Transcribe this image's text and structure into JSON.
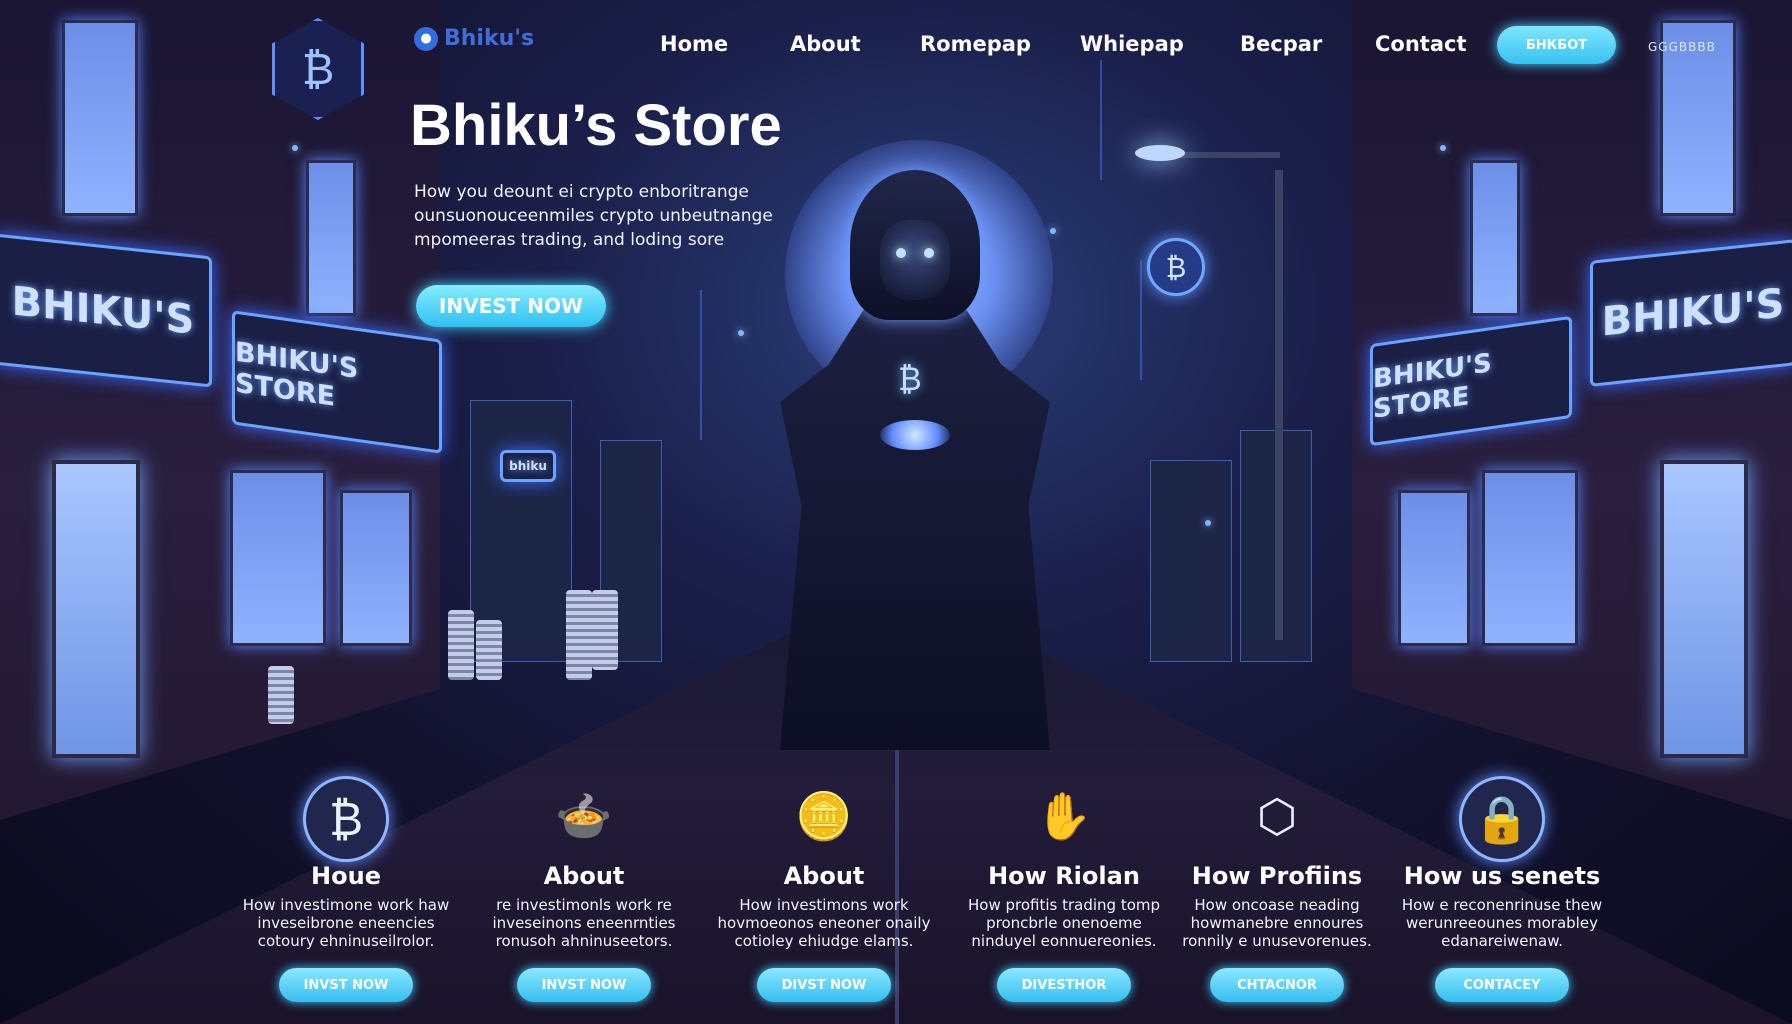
{
  "brand": {
    "logo_text": "Bhiku's",
    "logo_icon": "droplet-icon",
    "hex_logo_icon": "bitcoin-icon",
    "hex_logo_glyph": "₿"
  },
  "nav": {
    "items": [
      "Home",
      "About",
      "Romepap",
      "Whiepap",
      "Becpar",
      "Contact"
    ],
    "cta_label": "БНКБОТ",
    "extra_text": "GGGBBBB"
  },
  "hero": {
    "title": "Bhiku’s Store",
    "subtitle_lines": [
      "How you deount ei crypto enboritrange",
      "ounsuonouceenmiles crypto unbeutnange",
      "mpomeeras trading, and loding sore"
    ],
    "cta_label": "INVEST NOW"
  },
  "scene": {
    "signs": [
      "BHIKU'S",
      "BHIKU'S STORE",
      "BHIKU'S STORE",
      "BHIKU'S",
      "bhiku"
    ],
    "monk_glyph": "₿",
    "orb_glyph": "₿"
  },
  "features": [
    {
      "icon": "bitcoin-icon",
      "glyph": "₿",
      "title": "Houe",
      "desc": "How investimone work haw inveseibrone eneencies cotoury ehninuseilrolor.",
      "button": "INVST NOW"
    },
    {
      "icon": "pot-icon",
      "glyph": "🍲",
      "title": "About",
      "desc": "re investimonls work re inveseinons eneenrnties ronusoh ahninuseetors.",
      "button": "INVST NOW"
    },
    {
      "icon": "coin-stack-icon",
      "glyph": "🪙",
      "title": "About",
      "desc": "How investimons work hovmoeonos eneoner onaily cotioley ehiudge elams.",
      "button": "DIVST NOW"
    },
    {
      "icon": "handshake-icon",
      "glyph": "✋",
      "title": "How Riolan",
      "desc": "How profitis trading tomp proncbrle onenoeme ninduyel eonnuereonies.",
      "button": "DIVESTHOR"
    },
    {
      "icon": "hexagon-icon",
      "glyph": "⬡",
      "title": "How Profiins",
      "desc": "How oncoase neading howmanebre ennoures ronnily e unusevorenues.",
      "button": "CHTACNOR"
    },
    {
      "icon": "lock-icon",
      "glyph": "🔒",
      "title": "How us senets",
      "desc": "How e reconenrinuse thew werunreeounes morabley edanareiwenaw.",
      "button": "CONTACEY"
    }
  ],
  "colors": {
    "accent": "#3fc9ff",
    "neon": "#6aa4ff",
    "background": "#12122e"
  }
}
